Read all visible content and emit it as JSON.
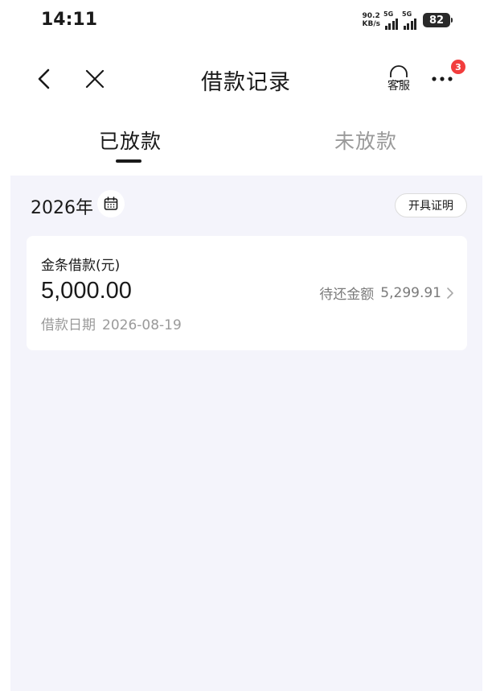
{
  "status_bar": {
    "time": "14:11",
    "net_speed_value": "90.2",
    "net_speed_unit": "KB/s",
    "sim1_label": "5G",
    "sim2_label": "5G",
    "battery": "82"
  },
  "nav": {
    "title": "借款记录",
    "service_label": "客服",
    "more_badge": "3"
  },
  "tabs": [
    {
      "label": "已放款",
      "active": true
    },
    {
      "label": "未放款",
      "active": false
    }
  ],
  "filter": {
    "year": "2026年",
    "certificate_label": "开具证明"
  },
  "loans": [
    {
      "name": "金条借款(元)",
      "amount": "5,000.00",
      "date_label": "借款日期",
      "date_value": "2026-08-19",
      "repay_label": "待还金额",
      "repay_value": "5,299.91"
    }
  ],
  "colors": {
    "background": "#f4f4fb",
    "badge": "#f23d3d",
    "muted_text": "#9a9a9a"
  }
}
